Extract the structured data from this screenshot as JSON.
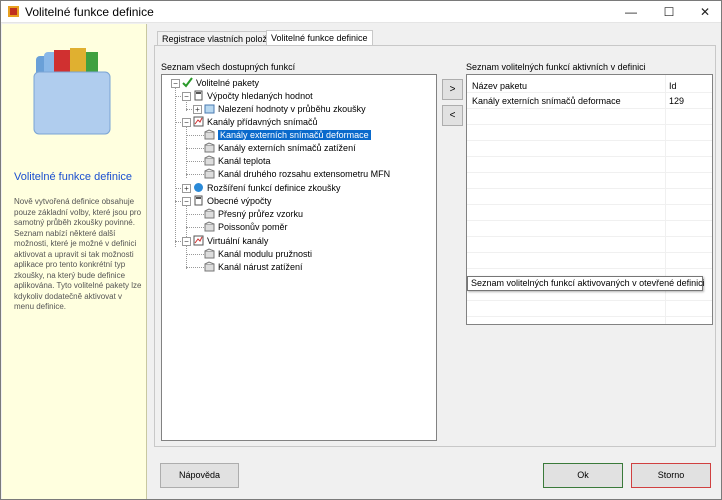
{
  "window": {
    "title": "Volitelné funkce definice"
  },
  "sidebar": {
    "title": "Volitelné funkce definice",
    "description": "Nově vytvořená definice obsahuje pouze základní volby, které jsou pro samotný průběh zkoušky povinné. Seznam nabízí některé další možnosti, které je možné v definici aktivovat a upravit si tak možnosti aplikace pro tento konkrétní typ zkoušky, na který bude definice aplikována. Tyto volitelné pakety lze kdykoliv dodatečně aktivovat v menu definice."
  },
  "tabs": [
    {
      "label": "Registrace vlastních položek"
    },
    {
      "label": "Volitelné funkce definice"
    }
  ],
  "left_panel": {
    "label": "Seznam všech dostupných funkcí",
    "tree": [
      {
        "label": "Volitelné pakety"
      },
      {
        "label": "Výpočty hledaných hodnot"
      },
      {
        "label": "Nalezení hodnoty v průběhu zkoušky"
      },
      {
        "label": "Kanály přídavných snímačů"
      },
      {
        "label": "Kanály externích snímačů deformace"
      },
      {
        "label": "Kanály externích snímačů zatížení"
      },
      {
        "label": "Kanál teplota"
      },
      {
        "label": "Kanál druhého rozsahu extensometru MFN"
      },
      {
        "label": "Rozšíření funkcí definice zkoušky"
      },
      {
        "label": "Obecné výpočty"
      },
      {
        "label": "Přesný průřez vzorku"
      },
      {
        "label": "Poissonův poměr"
      },
      {
        "label": "Virtuální kanály"
      },
      {
        "label": "Kanál modulu pružnosti"
      },
      {
        "label": "Kanál nárust zatížení"
      }
    ]
  },
  "move_buttons": {
    "add": ">",
    "remove": "<"
  },
  "right_panel": {
    "label": "Seznam volitelných funkcí aktivních v definici",
    "columns": [
      "Název paketu",
      "Id"
    ],
    "rows": [
      {
        "name": "Kanály externích snímačů deformace",
        "id": "129"
      }
    ],
    "tooltip": "Seznam volitelných funkcí aktivovaných v otevřené definici"
  },
  "buttons": {
    "help": "Nápověda",
    "ok": "Ok",
    "cancel": "Storno"
  },
  "colors": {
    "ok_border": "#3a7a3a",
    "cancel_border": "#d04040",
    "selection": "#0a6acc",
    "sidebar_bg": "#ffffdf"
  }
}
